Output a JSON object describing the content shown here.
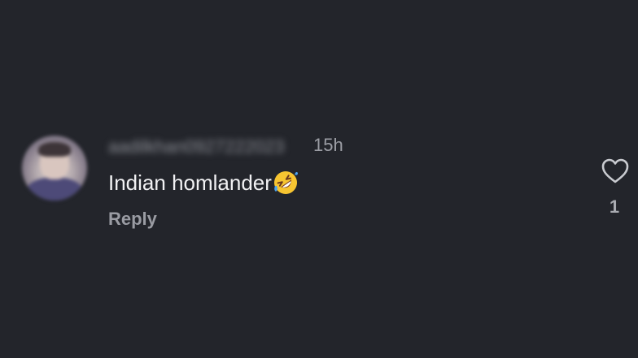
{
  "comment": {
    "username": "aadilkhan0927222023",
    "timestamp": "15h",
    "text": "Indian homlander",
    "emoji": "rolling-on-the-floor-laughing-emoji",
    "reply_label": "Reply",
    "like_count": "1"
  },
  "colors": {
    "background": "#23252b",
    "text_primary": "#f1f1f3",
    "text_secondary": "#9c9ea5",
    "emoji_yellow": "#f7c531"
  }
}
